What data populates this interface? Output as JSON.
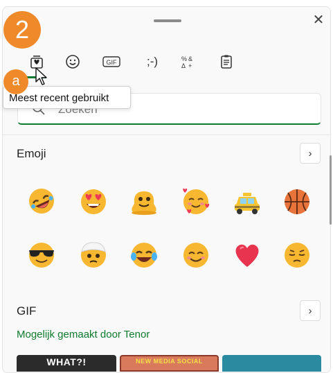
{
  "badges": {
    "step": "2",
    "substep": "a"
  },
  "tabs": [
    {
      "name": "meest-recent"
    },
    {
      "name": "emoji"
    },
    {
      "name": "gif",
      "label": "GIF"
    },
    {
      "name": "kaomoji",
      "label": ";-)"
    },
    {
      "name": "symbolen"
    },
    {
      "name": "klembord"
    }
  ],
  "tooltip": {
    "text": "Meest recent gebruikt"
  },
  "search": {
    "placeholder": "Zoeken"
  },
  "emoji_section": {
    "title": "Emoji",
    "items": [
      "rolling-on-floor-laughing",
      "smiling-face-with-heart-eyes",
      "melting-face",
      "smiling-face-with-hearts",
      "taxi",
      "basketball",
      "smiling-face-with-sunglasses",
      "face-with-head-bandage",
      "face-with-tears-of-joy",
      "smiling-face-with-smiling-eyes",
      "red-heart",
      "pensive-face"
    ]
  },
  "gif_section": {
    "title": "GIF",
    "attribution": "Mogelijk gemaakt door Tenor",
    "thumbs": [
      {
        "caption": "WHAT?!",
        "color": "#2b2b2b"
      },
      {
        "caption": "NEW MEDIA SOCIAL",
        "color": "#d97a5c"
      },
      {
        "caption": "",
        "color": "#2a8aa0"
      }
    ]
  },
  "colors": {
    "accent": "#0f7b2e",
    "badge": "#ef8a2b"
  }
}
